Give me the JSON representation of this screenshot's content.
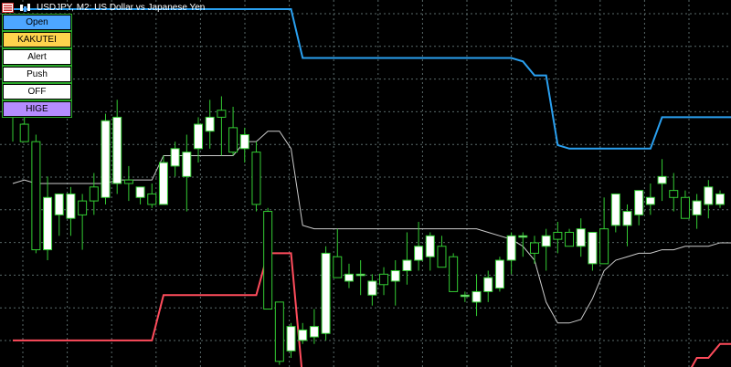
{
  "window": {
    "title": "USDJPY, M2:  US Dollar vs Japanese Yen",
    "icons": [
      "list-menu-icon",
      "chart-type-icon"
    ]
  },
  "panel": {
    "buttons": [
      {
        "id": "open",
        "label": "Open",
        "color": "#4da6ff"
      },
      {
        "id": "kakutei",
        "label": "KAKUTEI",
        "color": "#ffd34d"
      },
      {
        "id": "alert",
        "label": "Alert",
        "color": "#ffffff"
      },
      {
        "id": "push",
        "label": "Push",
        "color": "#ffffff"
      },
      {
        "id": "off",
        "label": "OFF",
        "color": "#ffffff"
      },
      {
        "id": "hige",
        "label": "HIGE",
        "color": "#b58cff"
      }
    ]
  },
  "chart_data": {
    "type": "candlestick",
    "symbol": "USDJPY",
    "timeframe": "M2",
    "grid": true,
    "colors": {
      "background": "#000000",
      "grid": "#5a6a6a",
      "bull_body": "#ffffff",
      "bear_body": "#000000",
      "wick": "#33cc33",
      "upper_band": "#2aa0f0",
      "lower_band": "#ff4c5c",
      "mid_line": "#cccccc"
    },
    "ylim": [
      0,
      100
    ],
    "candles": [
      {
        "o": 80,
        "h": 90,
        "l": 62,
        "c": 73
      },
      {
        "o": 67,
        "h": 71,
        "l": 63,
        "c": 62
      },
      {
        "o": 62,
        "h": 64,
        "l": 30,
        "c": 31
      },
      {
        "o": 31,
        "h": 52,
        "l": 28,
        "c": 46
      },
      {
        "o": 41,
        "h": 47,
        "l": 35,
        "c": 47
      },
      {
        "o": 40,
        "h": 49,
        "l": 35,
        "c": 47
      },
      {
        "o": 45,
        "h": 47,
        "l": 31,
        "c": 41
      },
      {
        "o": 49,
        "h": 53,
        "l": 41,
        "c": 45
      },
      {
        "o": 46,
        "h": 70,
        "l": 44,
        "c": 68
      },
      {
        "o": 50,
        "h": 74,
        "l": 47,
        "c": 69
      },
      {
        "o": 51,
        "h": 55,
        "l": 45,
        "c": 50
      },
      {
        "o": 46,
        "h": 49,
        "l": 44,
        "c": 49
      },
      {
        "o": 47,
        "h": 50,
        "l": 43,
        "c": 44
      },
      {
        "o": 44,
        "h": 58,
        "l": 44,
        "c": 56
      },
      {
        "o": 55,
        "h": 62,
        "l": 52,
        "c": 60
      },
      {
        "o": 52,
        "h": 64,
        "l": 42,
        "c": 59
      },
      {
        "o": 60,
        "h": 69,
        "l": 56,
        "c": 67
      },
      {
        "o": 65,
        "h": 74,
        "l": 60,
        "c": 69
      },
      {
        "o": 71,
        "h": 75,
        "l": 58,
        "c": 69
      },
      {
        "o": 66,
        "h": 72,
        "l": 58,
        "c": 59
      },
      {
        "o": 60,
        "h": 66,
        "l": 56,
        "c": 64
      },
      {
        "o": 59,
        "h": 62,
        "l": 42,
        "c": 44
      },
      {
        "o": 42,
        "h": 43,
        "l": 15,
        "c": 14
      },
      {
        "o": 16,
        "h": 16,
        "l": -2,
        "c": -1
      },
      {
        "o": 2,
        "h": 10,
        "l": 0,
        "c": 9
      },
      {
        "o": 5,
        "h": 10,
        "l": 4,
        "c": 8
      },
      {
        "o": 6,
        "h": 14,
        "l": 4,
        "c": 9
      },
      {
        "o": 7,
        "h": 32,
        "l": 5,
        "c": 30
      },
      {
        "o": 29,
        "h": 37,
        "l": 26,
        "c": 23
      },
      {
        "o": 22,
        "h": 27,
        "l": 20,
        "c": 24
      },
      {
        "o": 24,
        "h": 28,
        "l": 18,
        "c": 24
      },
      {
        "o": 18,
        "h": 24,
        "l": 15,
        "c": 22
      },
      {
        "o": 24,
        "h": 26,
        "l": 18,
        "c": 21
      },
      {
        "o": 22,
        "h": 28,
        "l": 15,
        "c": 25
      },
      {
        "o": 25,
        "h": 36,
        "l": 21,
        "c": 28
      },
      {
        "o": 28,
        "h": 39,
        "l": 25,
        "c": 32
      },
      {
        "o": 29,
        "h": 36,
        "l": 25,
        "c": 35
      },
      {
        "o": 32,
        "h": 35,
        "l": 28,
        "c": 26
      },
      {
        "o": 29,
        "h": 30,
        "l": 19,
        "c": 19
      },
      {
        "o": 18,
        "h": 19,
        "l": 16,
        "c": 18
      },
      {
        "o": 16,
        "h": 24,
        "l": 12,
        "c": 19
      },
      {
        "o": 19,
        "h": 25,
        "l": 16,
        "c": 23
      },
      {
        "o": 20,
        "h": 29,
        "l": 19,
        "c": 28
      },
      {
        "o": 28,
        "h": 36,
        "l": 24,
        "c": 35
      },
      {
        "o": 35,
        "h": 36,
        "l": 29,
        "c": 35
      },
      {
        "o": 33,
        "h": 35,
        "l": 27,
        "c": 30
      },
      {
        "o": 32,
        "h": 37,
        "l": 25,
        "c": 35
      },
      {
        "o": 36,
        "h": 39,
        "l": 30,
        "c": 34
      },
      {
        "o": 36,
        "h": 37,
        "l": 32,
        "c": 32
      },
      {
        "o": 32,
        "h": 40,
        "l": 29,
        "c": 37
      },
      {
        "o": 27,
        "h": 36,
        "l": 25,
        "c": 36
      },
      {
        "o": 37,
        "h": 46,
        "l": 27,
        "c": 27
      },
      {
        "o": 38,
        "h": 47,
        "l": 36,
        "c": 47
      },
      {
        "o": 38,
        "h": 44,
        "l": 32,
        "c": 42
      },
      {
        "o": 41,
        "h": 48,
        "l": 38,
        "c": 48
      },
      {
        "o": 44,
        "h": 50,
        "l": 41,
        "c": 46
      },
      {
        "o": 50,
        "h": 57,
        "l": 45,
        "c": 52
      },
      {
        "o": 48,
        "h": 53,
        "l": 42,
        "c": 46
      },
      {
        "o": 46,
        "h": 48,
        "l": 40,
        "c": 40
      },
      {
        "o": 41,
        "h": 47,
        "l": 37,
        "c": 45
      },
      {
        "o": 44,
        "h": 51,
        "l": 40,
        "c": 49
      },
      {
        "o": 44,
        "h": 48,
        "l": 43,
        "c": 47
      }
    ],
    "upper_band": [
      100,
      100,
      100,
      100,
      100,
      100,
      100,
      100,
      100,
      100,
      100,
      100,
      100,
      100,
      100,
      100,
      100,
      100,
      100,
      100,
      100,
      100,
      100,
      100,
      100,
      86,
      86,
      86,
      86,
      86,
      86,
      86,
      86,
      86,
      86,
      86,
      86,
      86,
      86,
      86,
      86,
      86,
      86,
      86,
      85,
      81,
      81,
      61,
      60,
      60,
      60,
      60,
      60,
      60,
      60,
      60,
      69,
      69,
      69,
      69,
      69,
      69,
      69
    ],
    "lower_band": [
      5,
      5,
      5,
      5,
      5,
      5,
      5,
      5,
      5,
      5,
      5,
      5,
      5,
      18,
      18,
      18,
      18,
      18,
      18,
      18,
      18,
      18,
      30,
      30,
      30,
      -6,
      -6,
      -6,
      -6,
      -6,
      -6,
      -6,
      -6,
      -6,
      -6,
      -6,
      -6,
      -6,
      -6,
      -6,
      -6,
      -6,
      -6,
      -6,
      -6,
      -6,
      -6,
      -6,
      -6,
      -6,
      -6,
      -6,
      -6,
      -6,
      -6,
      -6,
      -6,
      -6,
      -6,
      0,
      0,
      4,
      4
    ],
    "mid_line": [
      50,
      51,
      50,
      50,
      50,
      50,
      50,
      50,
      50,
      51,
      51,
      51,
      51,
      58,
      58,
      58,
      58,
      58,
      58,
      58,
      62,
      62,
      65,
      65,
      60,
      38,
      37,
      37,
      37,
      37,
      37,
      37,
      37,
      37,
      37,
      37,
      37,
      37,
      37,
      37,
      37,
      36,
      35,
      34,
      32,
      28,
      16,
      10,
      10,
      11,
      17,
      25,
      28,
      29,
      30,
      30,
      31,
      31,
      32,
      32,
      32,
      33,
      33
    ]
  }
}
